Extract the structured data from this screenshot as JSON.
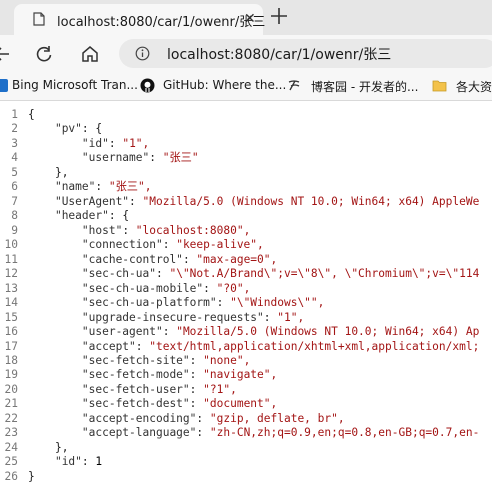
{
  "browser": {
    "tab_title": "localhost:8080/car/1/owenr/张三",
    "tab_close": "✕",
    "url": "localhost:8080/car/1/owenr/张三"
  },
  "bookmarks": [
    {
      "label": "Bing Microsoft Tran..."
    },
    {
      "label": "GitHub: Where the..."
    },
    {
      "label": "博客园 - 开发者的..."
    },
    {
      "label": "各大资"
    }
  ],
  "json_view": {
    "line_numbers": [
      "1",
      "2",
      "3",
      "4",
      "5",
      "6",
      "7",
      "8",
      "9",
      "10",
      "11",
      "12",
      "13",
      "14",
      "15",
      "16",
      "17",
      "18",
      "19",
      "20",
      "21",
      "22",
      "23",
      "24",
      "25",
      "26"
    ],
    "lines": [
      {
        "indent": "",
        "key": "",
        "value": "{",
        "kind": "punct"
      },
      {
        "indent": "    ",
        "key": "\"pv\"",
        "value": ": {",
        "kind": "punct"
      },
      {
        "indent": "        ",
        "key": "\"id\"",
        "value": "\"1\",",
        "kind": "str"
      },
      {
        "indent": "        ",
        "key": "\"username\"",
        "value": "\"张三\"",
        "kind": "str"
      },
      {
        "indent": "    ",
        "key": "",
        "value": "},",
        "kind": "punct"
      },
      {
        "indent": "    ",
        "key": "\"name\"",
        "value": "\"张三\",",
        "kind": "str"
      },
      {
        "indent": "    ",
        "key": "\"UserAgent\"",
        "value": "\"Mozilla/5.0 (Windows NT 10.0; Win64; x64) AppleWe",
        "kind": "str"
      },
      {
        "indent": "    ",
        "key": "\"header\"",
        "value": ": {",
        "kind": "punct"
      },
      {
        "indent": "        ",
        "key": "\"host\"",
        "value": "\"localhost:8080\",",
        "kind": "str"
      },
      {
        "indent": "        ",
        "key": "\"connection\"",
        "value": "\"keep-alive\",",
        "kind": "str"
      },
      {
        "indent": "        ",
        "key": "\"cache-control\"",
        "value": "\"max-age=0\",",
        "kind": "str"
      },
      {
        "indent": "        ",
        "key": "\"sec-ch-ua\"",
        "value": "\"\\\"Not.A/Brand\\\";v=\\\"8\\\", \\\"Chromium\\\";v=\\\"114",
        "kind": "str"
      },
      {
        "indent": "        ",
        "key": "\"sec-ch-ua-mobile\"",
        "value": "\"?0\",",
        "kind": "str"
      },
      {
        "indent": "        ",
        "key": "\"sec-ch-ua-platform\"",
        "value": "\"\\\"Windows\\\"\",",
        "kind": "str"
      },
      {
        "indent": "        ",
        "key": "\"upgrade-insecure-requests\"",
        "value": "\"1\",",
        "kind": "str"
      },
      {
        "indent": "        ",
        "key": "\"user-agent\"",
        "value": "\"Mozilla/5.0 (Windows NT 10.0; Win64; x64) Ap",
        "kind": "str"
      },
      {
        "indent": "        ",
        "key": "\"accept\"",
        "value": "\"text/html,application/xhtml+xml,application/xml;",
        "kind": "str"
      },
      {
        "indent": "        ",
        "key": "\"sec-fetch-site\"",
        "value": "\"none\",",
        "kind": "str"
      },
      {
        "indent": "        ",
        "key": "\"sec-fetch-mode\"",
        "value": "\"navigate\",",
        "kind": "str"
      },
      {
        "indent": "        ",
        "key": "\"sec-fetch-user\"",
        "value": "\"?1\",",
        "kind": "str"
      },
      {
        "indent": "        ",
        "key": "\"sec-fetch-dest\"",
        "value": "\"document\",",
        "kind": "str"
      },
      {
        "indent": "        ",
        "key": "\"accept-encoding\"",
        "value": "\"gzip, deflate, br\",",
        "kind": "str"
      },
      {
        "indent": "        ",
        "key": "\"accept-language\"",
        "value": "\"zh-CN,zh;q=0.9,en;q=0.8,en-GB;q=0.7,en-",
        "kind": "str"
      },
      {
        "indent": "    ",
        "key": "",
        "value": "},",
        "kind": "punct"
      },
      {
        "indent": "    ",
        "key": "\"id\"",
        "value": "1",
        "kind": "num"
      },
      {
        "indent": "",
        "key": "",
        "value": "}",
        "kind": "punct"
      }
    ]
  },
  "icons": {
    "tab": "page-icon",
    "new_tab": "plus-icon",
    "back": "back-arrow-icon",
    "reload": "reload-icon",
    "home": "home-icon",
    "site_info": "info-icon"
  }
}
